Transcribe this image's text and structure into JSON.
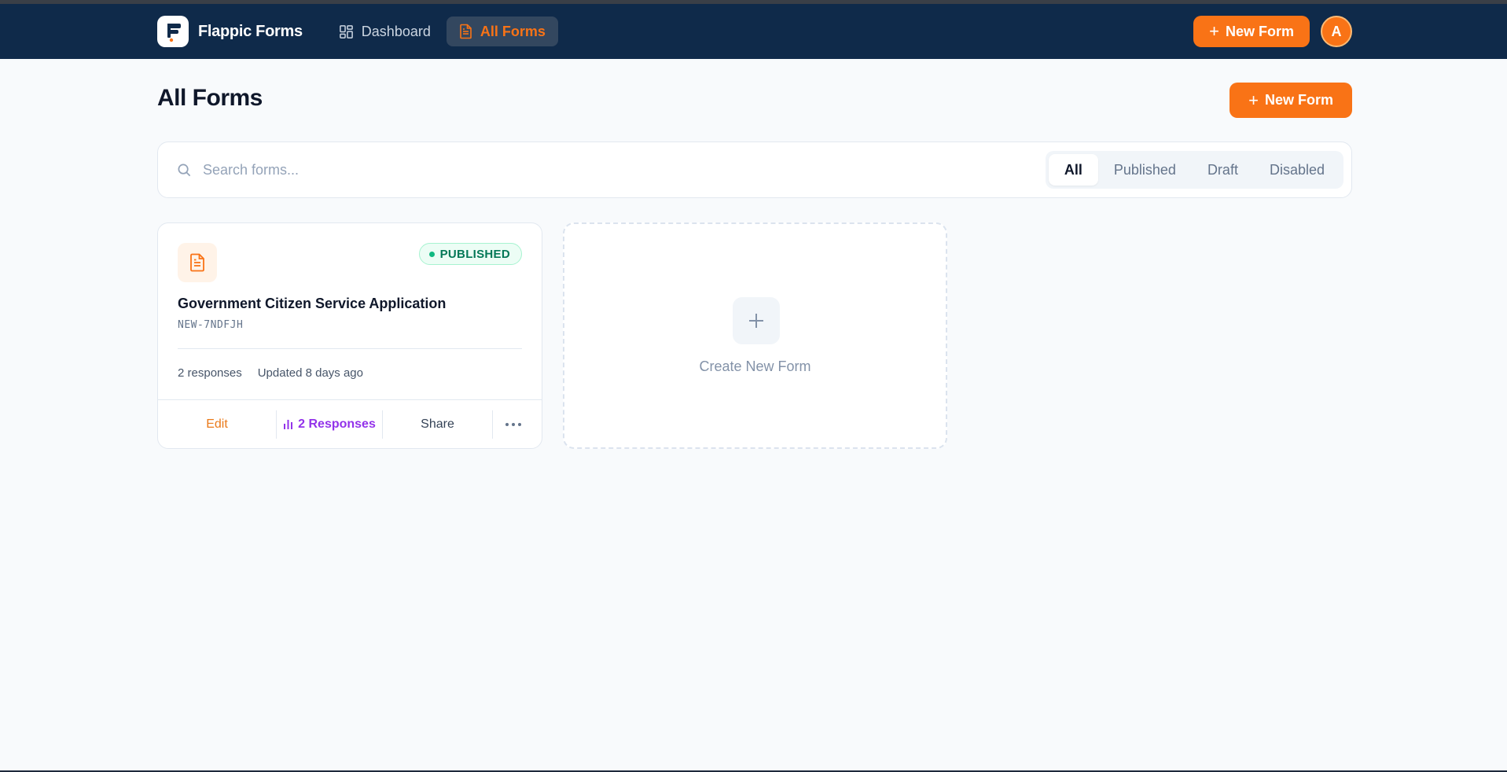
{
  "app": {
    "brand": "Flappic Forms",
    "avatar_initial": "A"
  },
  "nav": {
    "dashboard": "Dashboard",
    "all_forms": "All Forms",
    "new_form": "New Form"
  },
  "page": {
    "title": "All Forms",
    "new_form": "New Form"
  },
  "search": {
    "placeholder": "Search forms...",
    "value": ""
  },
  "filters": [
    "All",
    "Published",
    "Draft",
    "Disabled"
  ],
  "selected_filter": "All",
  "forms": [
    {
      "title": "Government Citizen Service Application",
      "code": "NEW-7NDFJH",
      "status": "PUBLISHED",
      "responses_count": "2 responses",
      "updated": "Updated 8 days ago",
      "actions": {
        "edit": "Edit",
        "responses": "2 Responses",
        "share": "Share"
      }
    }
  ],
  "create_card": {
    "label": "Create New Form"
  },
  "colors": {
    "navbar": "#0f2a4a",
    "accent": "#f97316",
    "published": "#047857",
    "responses": "#9333ea"
  },
  "icons": {
    "logo": "flappic-logo-icon",
    "dashboard": "grid-icon",
    "all_forms": "document-icon",
    "search": "search-icon",
    "form": "document-icon",
    "responses": "bar-chart-icon",
    "more": "more-horizontal-icon",
    "create": "plus-icon"
  }
}
